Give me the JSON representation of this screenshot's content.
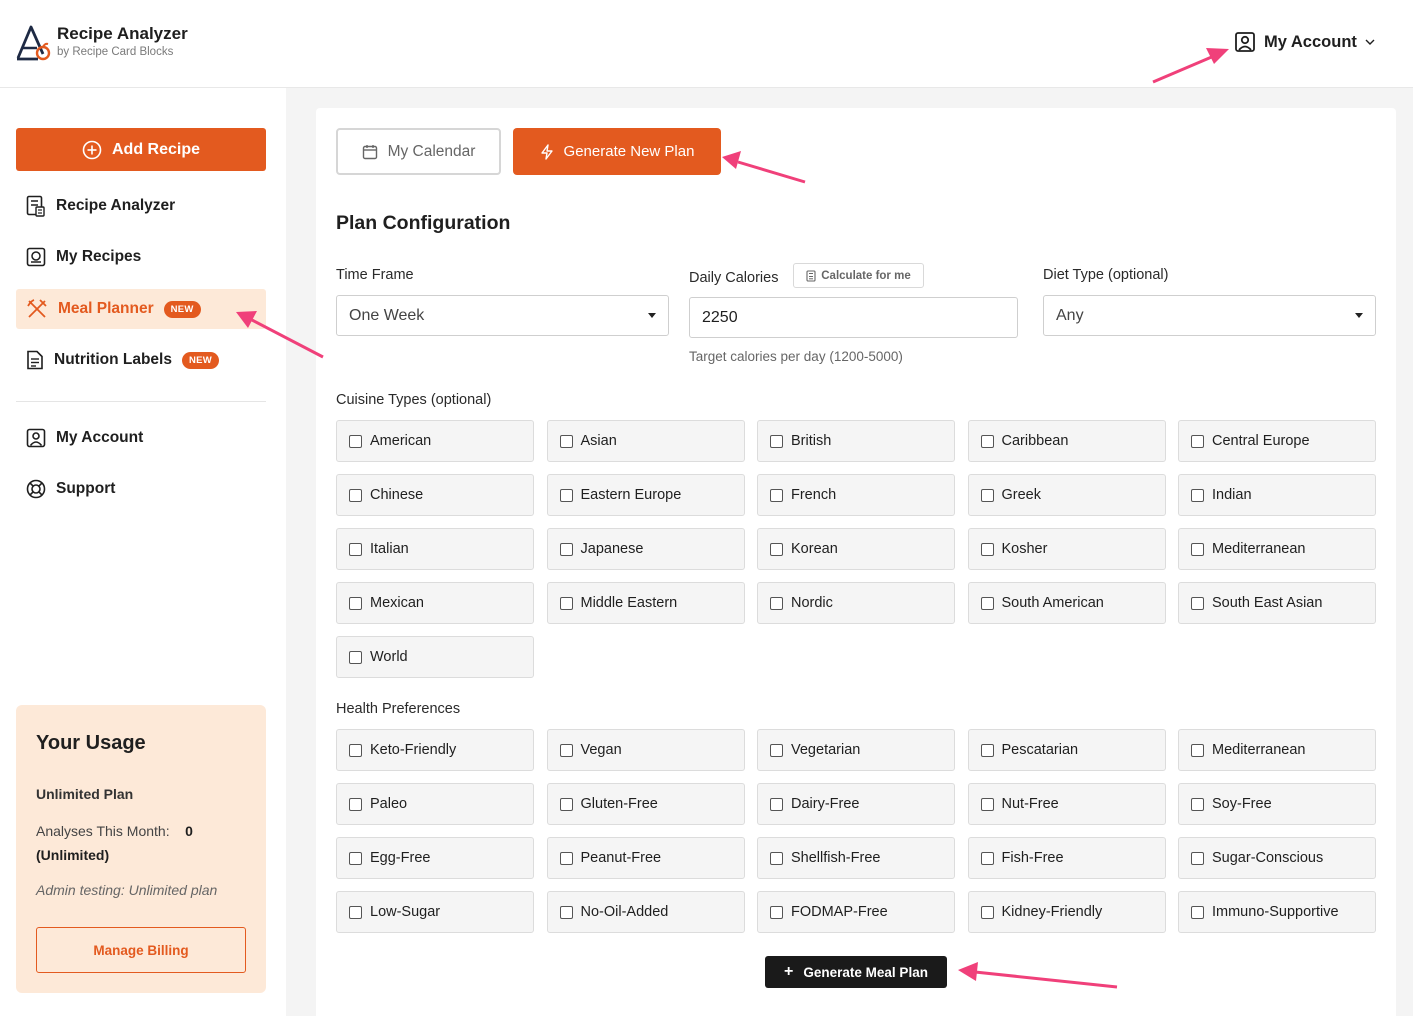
{
  "header": {
    "brand_title": "Recipe Analyzer",
    "brand_subtitle": "by Recipe Card Blocks",
    "account_label": "My Account"
  },
  "sidebar": {
    "add_recipe_label": "Add Recipe",
    "items": [
      {
        "label": "Recipe Analyzer",
        "icon": "calculator-icon",
        "badge": "",
        "active": false
      },
      {
        "label": "My Recipes",
        "icon": "recipe-book-icon",
        "badge": "",
        "active": false
      },
      {
        "label": "Meal Planner",
        "icon": "utensils-icon",
        "badge": "NEW",
        "active": true
      },
      {
        "label": "Nutrition Labels",
        "icon": "document-icon",
        "badge": "NEW",
        "active": false
      },
      {
        "label": "My Account",
        "icon": "user-icon",
        "badge": "",
        "active": false
      },
      {
        "label": "Support",
        "icon": "lifebuoy-icon",
        "badge": "",
        "active": false
      }
    ],
    "usage": {
      "title": "Your Usage",
      "plan": "Unlimited Plan",
      "analyses_label": "Analyses This Month:",
      "analyses_value": "0",
      "analyses_suffix": "(Unlimited)",
      "note": "Admin testing: Unlimited plan",
      "billing_label": "Manage Billing"
    }
  },
  "main": {
    "calendar_label": "My Calendar",
    "generate_new_label": "Generate New Plan",
    "section_title": "Plan Configuration",
    "time_frame": {
      "label": "Time Frame",
      "value": "One Week"
    },
    "daily_calories": {
      "label": "Daily Calories",
      "calc_label": "Calculate for me",
      "value": "2250",
      "hint": "Target calories per day (1200-5000)"
    },
    "diet_type": {
      "label": "Diet Type (optional)",
      "value": "Any"
    },
    "cuisine_label": "Cuisine Types (optional)",
    "cuisines": [
      "American",
      "Asian",
      "British",
      "Caribbean",
      "Central Europe",
      "Chinese",
      "Eastern Europe",
      "French",
      "Greek",
      "Indian",
      "Italian",
      "Japanese",
      "Korean",
      "Kosher",
      "Mediterranean",
      "Mexican",
      "Middle Eastern",
      "Nordic",
      "South American",
      "South East Asian",
      "World"
    ],
    "health_label": "Health Preferences",
    "health": [
      "Keto-Friendly",
      "Vegan",
      "Vegetarian",
      "Pescatarian",
      "Mediterranean",
      "Paleo",
      "Gluten-Free",
      "Dairy-Free",
      "Nut-Free",
      "Soy-Free",
      "Egg-Free",
      "Peanut-Free",
      "Shellfish-Free",
      "Fish-Free",
      "Sugar-Conscious",
      "Low-Sugar",
      "No-Oil-Added",
      "FODMAP-Free",
      "Kidney-Friendly",
      "Immuno-Supportive"
    ],
    "generate_meal_label": "Generate Meal Plan"
  },
  "colors": {
    "accent": "#e35a1f",
    "accent_light": "#fde9d8",
    "annotation_arrow": "#f0407a",
    "dark_button": "#1a1a1a"
  }
}
